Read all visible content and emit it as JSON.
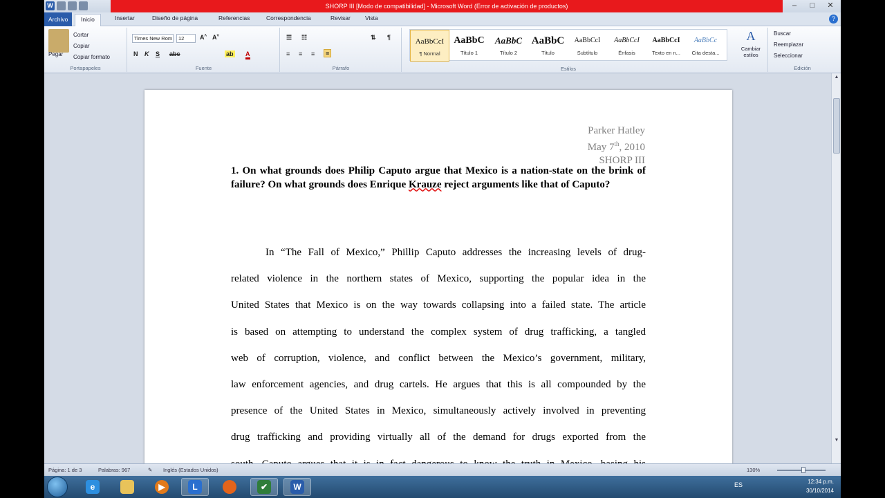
{
  "window": {
    "title": "SHORP III [Modo de compatibilidad] - Microsoft Word (Error de activación de productos)",
    "controls": [
      "–",
      "□",
      "✕"
    ]
  },
  "tabs": [
    {
      "label": "Archivo"
    },
    {
      "label": "Inicio"
    },
    {
      "label": "Insertar"
    },
    {
      "label": "Diseño de página"
    },
    {
      "label": "Referencias"
    },
    {
      "label": "Correspondencia"
    },
    {
      "label": "Revisar"
    },
    {
      "label": "Vista"
    }
  ],
  "ribbon": {
    "clipboard": {
      "paste": "Pegar",
      "cut": "Cortar",
      "copy": "Copiar",
      "format_painter": "Copiar formato",
      "label": "Portapapeles"
    },
    "font": {
      "name": "Times New Rom",
      "size": "12",
      "label": "Fuente"
    },
    "paragraph": {
      "label": "Párrafo"
    },
    "styles": {
      "label": "Estilos",
      "items": [
        {
          "preview": "AaBbCcI",
          "name": "¶ Normal",
          "selected": true
        },
        {
          "preview": "AaBbC",
          "name": "Título 1"
        },
        {
          "preview": "AaBbC",
          "name": "Título 2"
        },
        {
          "preview": "AaBbC",
          "name": "Título"
        },
        {
          "preview": "AaBbCcI",
          "name": "Subtítulo"
        },
        {
          "preview": "AaBbCcI",
          "name": "Énfasis"
        },
        {
          "preview": "AaBbCcI",
          "name": "Texto en n..."
        },
        {
          "preview": "AaBbCc",
          "name": "Cita desta..."
        }
      ],
      "change": "Cambiar estilos"
    },
    "editing": {
      "find": "Buscar",
      "replace": "Reemplazar",
      "select": "Seleccionar",
      "label": "Edición"
    }
  },
  "document": {
    "header": {
      "name": "Parker Hatley",
      "date_main": "May 7",
      "date_sup": "th",
      "date_year": ", 2010",
      "course": "SHORP III"
    },
    "question": {
      "before": "1. On what grounds does Philip Caputo argue that Mexico is a nation-state on the brink of failure? On what grounds does Enrique ",
      "underlined": "Krauze",
      "after": " reject arguments like that of Caputo?"
    },
    "body_lines": [
      "In “The Fall of Mexico,” Phillip Caputo addresses the increasing levels of drug-",
      "related violence in the northern states of Mexico, supporting the popular idea in the",
      "United States that Mexico is on the way towards collapsing into a failed state. The article",
      "is based on attempting to understand the complex system of drug trafficking, a tangled",
      "web of corruption, violence, and conflict between the Mexico’s government, military,",
      "law enforcement agencies, and drug cartels. He argues that this is all compounded by the",
      "presence of the United States in Mexico, simultaneously actively involved in preventing",
      "drug trafficking and providing virtually all of the demand for drugs exported from the",
      "south. Caputo argues that it is in fact dangerous to know the truth in Mexico, basing his"
    ]
  },
  "statusbar": {
    "page": "Página: 1 de 3",
    "words": "Palabras: 967",
    "language": "Inglés (Estados Unidos)",
    "zoom": "130%"
  },
  "taskbar": {
    "time": "12:34 p.m.",
    "date": "30/10/2014",
    "lang": "ES"
  }
}
